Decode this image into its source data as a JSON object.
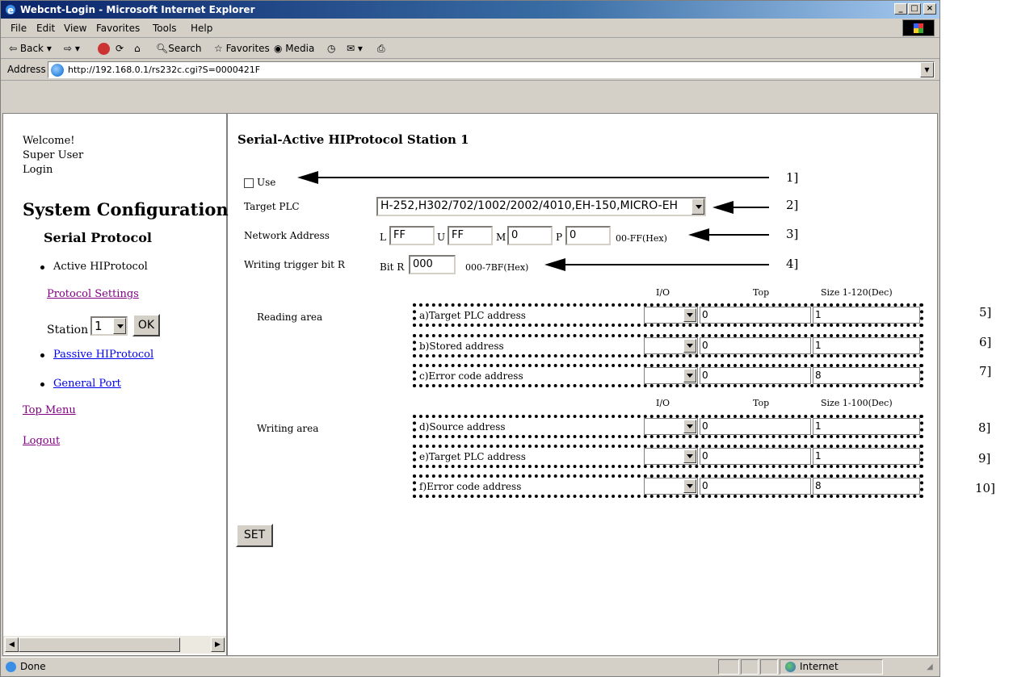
{
  "window": {
    "title": "Webcnt-Login - Microsoft Internet Explorer"
  },
  "caption_buttons": {
    "minimize": "_",
    "maximize": "□",
    "close": "×"
  },
  "menu": [
    "File",
    "Edit",
    "View",
    "Favorites",
    "Tools",
    "Help"
  ],
  "toolbar": {
    "back": "Back",
    "search": "Search",
    "favorites": "Favorites",
    "media": "Media"
  },
  "address": {
    "label": "Address",
    "url": "http://192.168.0.1/rs232c.cgi?S=0000421F"
  },
  "sidebar": {
    "welcome": "Welcome!",
    "user": "Super User",
    "login": "Login",
    "title": "System Configuration",
    "section": "Serial Protocol",
    "active": "Active HIProtocol",
    "protocol_settings": "Protocol Settings",
    "station_label": "Station",
    "station_value": "1",
    "ok": "OK",
    "passive": "Passive HIProtocol",
    "general": "General Port",
    "top_menu": "Top Menu",
    "logout": "Logout"
  },
  "form": {
    "heading": "Serial-Active HIProtocol Station 1",
    "use_label": "Use",
    "target_plc_label": "Target PLC",
    "target_plc_value": "H-252,H302/702/1002/2002/4010,EH-150,MICRO-EH",
    "network_label": "Network Address",
    "net_L_label": "L",
    "net_L": "FF",
    "net_U_label": "U",
    "net_U": "FF",
    "net_M_label": "M",
    "net_M": "0",
    "net_P_label": "P",
    "net_P": "0",
    "net_hint": "00-FF(Hex)",
    "trigger_label": "Writing trigger bit R",
    "trigger_prefix": "Bit R",
    "trigger_value": "000",
    "trigger_hint": "000-7BF(Hex)",
    "col_io": "I/O",
    "col_top": "Top",
    "col_size_read": "Size 1-120(Dec)",
    "col_size_write": "Size 1-100(Dec)",
    "reading_area": "Reading area",
    "writing_area": "Writing area",
    "rows": [
      {
        "label": "a)Target PLC address",
        "top": "0",
        "size": "1"
      },
      {
        "label": "b)Stored address",
        "top": "0",
        "size": "1"
      },
      {
        "label": "c)Error code address",
        "top": "0",
        "size": "8"
      },
      {
        "label": "d)Source address",
        "top": "0",
        "size": "1"
      },
      {
        "label": "e)Target PLC address",
        "top": "0",
        "size": "1"
      },
      {
        "label": "f)Error code address",
        "top": "0",
        "size": "8"
      }
    ],
    "set": "SET"
  },
  "status": {
    "text": "Done",
    "zone": "Internet"
  },
  "annotations": [
    "1]",
    "2]",
    "3]",
    "4]",
    "5]",
    "6]",
    "7]",
    "8]",
    "9]",
    "10]"
  ]
}
